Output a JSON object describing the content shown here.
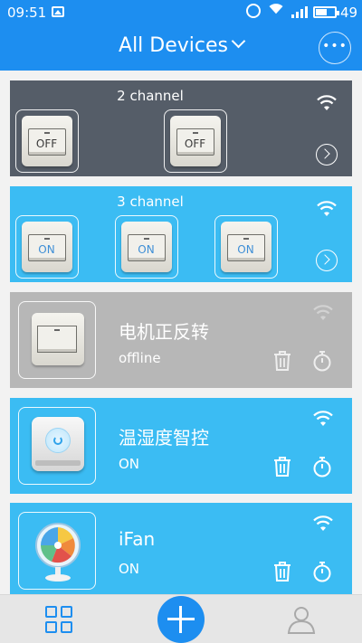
{
  "status_bar": {
    "time": "09:51",
    "battery": "49"
  },
  "header": {
    "title": "All Devices",
    "more_label": "•••"
  },
  "cards": [
    {
      "title": "2 channel",
      "switches": [
        "OFF",
        "OFF"
      ],
      "online": true
    },
    {
      "title": "3 channel",
      "switches": [
        "ON",
        "ON",
        "ON"
      ],
      "online": true
    },
    {
      "name": "电机正反转",
      "status": "offline",
      "icon": "wall-switch-icon"
    },
    {
      "name": "温湿度智控",
      "status": "ON",
      "icon": "thermostat-device-icon"
    },
    {
      "name": "iFan",
      "status": "ON",
      "icon": "fan-icon"
    }
  ],
  "colors": {
    "primary": "#1d8ef0",
    "card_blue": "#3bbcf3",
    "card_dark": "#555d68",
    "card_offline": "#b7b7b7"
  },
  "bottom_nav": {
    "items": [
      "grid-icon",
      "add-icon",
      "user-icon"
    ]
  }
}
